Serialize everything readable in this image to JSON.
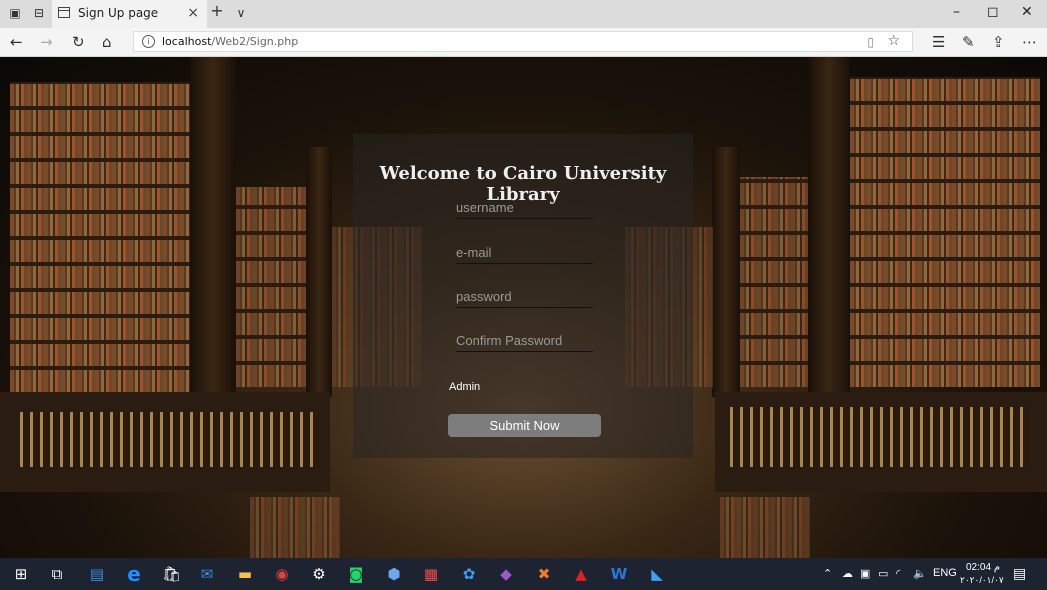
{
  "browser": {
    "tab_title": "Sign Up page",
    "tab_close": "×",
    "new_tab": "+",
    "tab_menu": "∨",
    "url_host": "localhost",
    "url_path": "/Web2/Sign.php",
    "window_controls": [
      "–",
      "◻",
      "✕"
    ]
  },
  "panel": {
    "title": "Welcome to Cairo University Library",
    "username_placeholder": "username",
    "email_placeholder": "e-mail",
    "password_placeholder": "password",
    "confirm_placeholder": "Confirm Password",
    "admin_label": "Admin",
    "submit_label": "Submit Now"
  },
  "taskbar": {
    "language": "ENG",
    "time": "02:04 م",
    "date": "٢٠٢٠/٠١/٠٧"
  },
  "icons": [
    "tab-actions-icon",
    "tab-aside-icon",
    "page-icon",
    "back-icon",
    "forward-icon",
    "refresh-icon",
    "home-icon",
    "info-icon",
    "reading-view-icon",
    "favorite-star-icon",
    "favorites-hub-icon",
    "pen-icon",
    "share-icon",
    "more-icon",
    "windows-start-icon",
    "task-view-icon",
    "edge-icon",
    "store-icon",
    "mail-icon",
    "file-explorer-icon",
    "chrome-icon",
    "settings-icon",
    "whatsapp-icon",
    "box-icon",
    "grid-app-icon",
    "photos-icon",
    "visual-studio-icon",
    "xampp-icon",
    "acrobat-icon",
    "word-icon",
    "vscode-icon",
    "notification-icon"
  ]
}
